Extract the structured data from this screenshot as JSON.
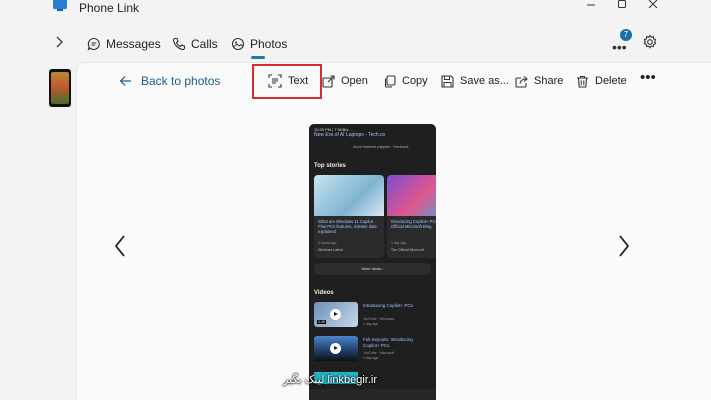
{
  "window": {
    "title": "Phone Link",
    "controls": [
      "minimize",
      "maximize",
      "close"
    ]
  },
  "nav": {
    "tabs": [
      {
        "label": "Messages",
        "icon": "messages-icon"
      },
      {
        "label": "Calls",
        "icon": "phone-icon"
      },
      {
        "label": "Photos",
        "icon": "photos-icon",
        "active": true
      }
    ],
    "notification_count": "7",
    "accent_color": "#1a7fa0"
  },
  "toolbar": {
    "back_label": "Back to photos",
    "text_label": "Text",
    "open_label": "Open",
    "copy_label": "Copy",
    "save_label": "Save as...",
    "share_label": "Share",
    "delete_label": "Delete",
    "more_label": "•••",
    "highlight_color": "#d32f2f"
  },
  "photo": {
    "status_bar": "10:39 PM | 7.0KB/s ...",
    "header": "New Era of AI Laptops - Tech.co",
    "header_meta": "About featured snippets  ·  Feedback",
    "top_stories_label": "Top stories",
    "cards": [
      {
        "title": "What are Windows 11 Copilot Plus PCs features, release date explained",
        "time": "2 hours ago",
        "source": "Windows Latest"
      },
      {
        "title": "Introducing Copilot+ PCs - The Official Microsoft Blog",
        "time": "1 day ago",
        "source": "The Official Microsoft"
      }
    ],
    "more_news_label": "More news  ›",
    "videos_label": "Videos",
    "videos": [
      {
        "title": "Introducing Copilot+ PCs",
        "meta": "YouTube · Windows",
        "age": "1 day ago",
        "duration": "0:36"
      },
      {
        "title": "Full Keynote: Introducing Copilot+ PCs",
        "meta": "YouTube · Microsoft",
        "age": "1 day ago"
      }
    ]
  },
  "watermark": "لینک بگیر  linkbegir.ir"
}
